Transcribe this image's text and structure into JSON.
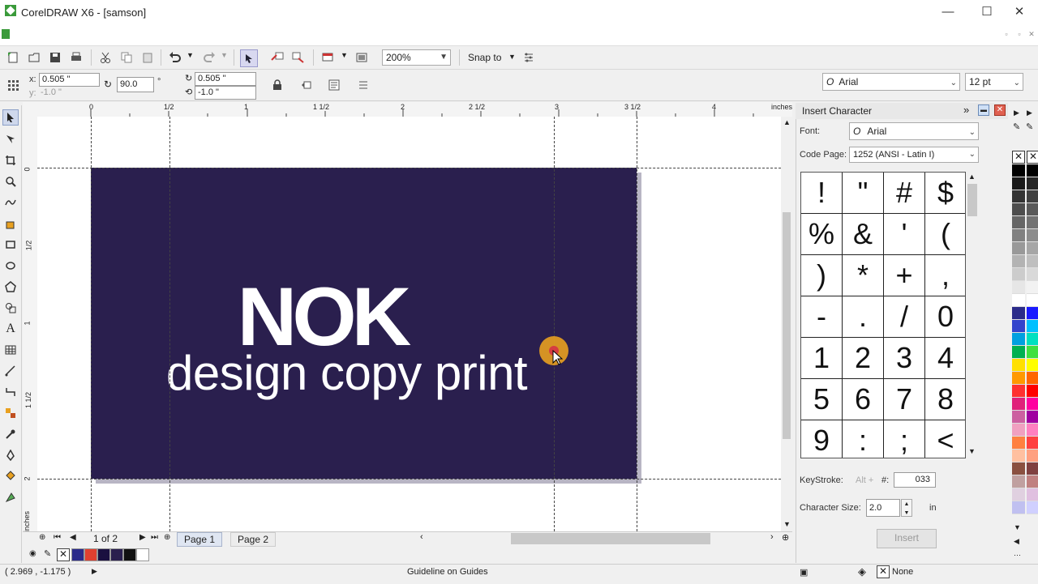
{
  "window": {
    "title": "CorelDRAW X6 - [samson]",
    "minimize": "—",
    "maximize": "☐",
    "close": "✕"
  },
  "standard_toolbar": {
    "zoom": "200%",
    "snap_to": "Snap to"
  },
  "property_bar": {
    "x_label": "x:",
    "x_value": "0.505 \"",
    "y_label": "y:",
    "y_value": "-1.0 \"",
    "angle_value": "90.0",
    "angle_unit": "°",
    "w_value": "0.505 \"",
    "h_value": "-1.0 \"",
    "font": "Arial",
    "font_size": "12 pt"
  },
  "ruler": {
    "units": "inches",
    "h_ticks": [
      "0",
      "1/2",
      "1",
      "1 1/2",
      "2",
      "2 1/2",
      "3",
      "3 1/2",
      "4"
    ],
    "v_ticks": [
      "0",
      "1/2",
      "1",
      "1 1/2",
      "2"
    ],
    "v_units": "inches"
  },
  "canvas": {
    "headline": "NOK",
    "tagline": "design copy print",
    "card_color": "#2a1f4e"
  },
  "page_nav": {
    "page_count": "1 of 2",
    "tabs": [
      "Page 1",
      "Page 2"
    ]
  },
  "status": {
    "coords": "( 2.969 , -1.175 )",
    "message": "Guideline on Guides",
    "fill": "None"
  },
  "docker": {
    "title": "Insert Character",
    "font_label": "Font:",
    "font_value": "Arial",
    "code_page_label": "Code Page:",
    "code_page_value": "1252  (ANSI - Latin I)",
    "characters": [
      "!",
      "\"",
      "#",
      "$",
      "%",
      "&",
      "'",
      "(",
      ")",
      "*",
      "+",
      ",",
      "-",
      ".",
      "/",
      "0",
      "1",
      "2",
      "3",
      "4",
      "5",
      "6",
      "7",
      "8",
      "9",
      ":",
      ";",
      "<"
    ],
    "keystroke_label": "KeyStroke:",
    "alt_label": "Alt +",
    "hash_label": "#:",
    "keystroke_value": "033",
    "char_size_label": "Character Size:",
    "char_size_value": "2.0",
    "char_size_unit": "in",
    "insert_button": "Insert"
  },
  "doc_palette": [
    "#2a2a8a",
    "#e04030",
    "#1a1040",
    "#2a1f4e",
    "#111111",
    "#ffffff"
  ],
  "palette_col1": [
    "#000000",
    "#1a1a1a",
    "#333333",
    "#4d4d4d",
    "#666666",
    "#808080",
    "#999999",
    "#b3b3b3",
    "#cccccc",
    "#e6e6e6",
    "#ffffff",
    "#2b2b8a",
    "#3344cc",
    "#00a0e0",
    "#00b050",
    "#ffe000",
    "#ff9900",
    "#ff3030",
    "#e0207a",
    "#cc60a0",
    "#f0a0c0",
    "#ff8040",
    "#ffc0a0",
    "#8a5040",
    "#c0a0a0",
    "#e0d0e0",
    "#c0c0f0",
    "#a0a0e0",
    "#8080c0",
    "#6060a0"
  ],
  "palette_col2": [
    "#000000",
    "#262626",
    "#404040",
    "#595959",
    "#737373",
    "#8c8c8c",
    "#a6a6a6",
    "#bfbfbf",
    "#d9d9d9",
    "#f2f2f2",
    "#ffffff",
    "#1a1aff",
    "#00c0ff",
    "#00e0c0",
    "#40e040",
    "#ffff00",
    "#ff6600",
    "#ff0000",
    "#ff00a0",
    "#a000a0",
    "#ff80c0",
    "#ff4040",
    "#ffa080",
    "#804040",
    "#c08080",
    "#e0c0e0",
    "#d0d0ff",
    "#b0b0f0",
    "#9090d0",
    "#7070b0"
  ]
}
